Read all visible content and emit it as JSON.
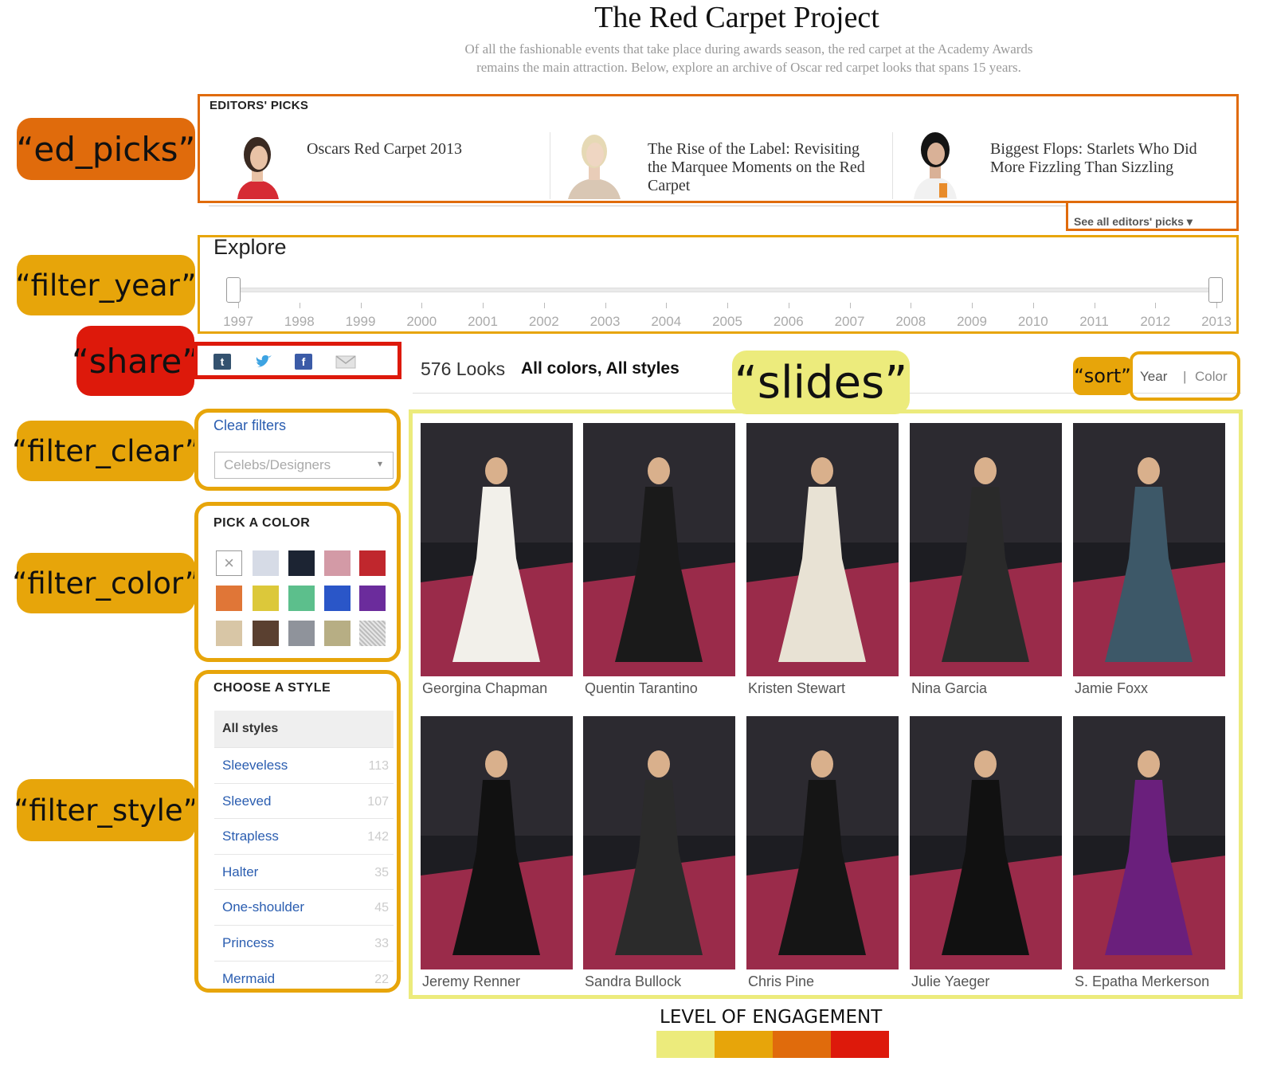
{
  "header": {
    "title": "The Red Carpet Project",
    "subtitle_line1": "Of all the fashionable events that take place during awards season, the red carpet at the Academy Awards",
    "subtitle_line2": "remains the main attraction. Below, explore an archive of Oscar red carpet looks that spans 15 years."
  },
  "annotations": {
    "ed_picks": "“ed_picks”",
    "filter_year": "“filter_year”",
    "share": "“share”",
    "filter_clear": "“filter_clear”",
    "filter_color": "“filter_color”",
    "filter_style": "“filter_style”",
    "slides": "“slides”",
    "sort": "“sort”"
  },
  "editors_picks": {
    "header": "EDITORS' PICKS",
    "items": [
      {
        "title": "Oscars Red Carpet 2013"
      },
      {
        "title": "The Rise of the Label: Revisiting the Marquee Moments on the Red Carpet"
      },
      {
        "title": "Biggest Flops: Starlets Who Did More Fizzling Than Sizzling"
      }
    ],
    "see_all": "See all editors' picks ▾"
  },
  "explore": {
    "label": "Explore",
    "years": [
      "1997",
      "1998",
      "1999",
      "2000",
      "2001",
      "2002",
      "2003",
      "2004",
      "2005",
      "2006",
      "2007",
      "2008",
      "2009",
      "2010",
      "2011",
      "2012",
      "2013"
    ],
    "selected_range": [
      "1997",
      "2013"
    ]
  },
  "share": {
    "icons": [
      "tumblr-icon",
      "twitter-icon",
      "facebook-icon",
      "email-icon"
    ],
    "tumblr_glyph": "t",
    "facebook_glyph": "f"
  },
  "looks": {
    "count": "576 Looks",
    "filters": "All colors, All styles"
  },
  "sort": {
    "year": "Year",
    "separator": "|",
    "color": "Color"
  },
  "filter_clear": {
    "link": "Clear filters",
    "select_value": "Celebs/Designers",
    "select_arrow": "▾"
  },
  "filter_color": {
    "title": "PICK A COLOR",
    "clear_glyph": "×",
    "swatches": [
      "#ffffff",
      "#d6dbe6",
      "#1c2433",
      "#d39aa6",
      "#c0272d",
      "#e07637",
      "#dcc83a",
      "#5cbf8c",
      "#2a56c8",
      "#6b2c9c",
      "#d8c6a6",
      "#5a4030",
      "#8f939b",
      "#b7ae84",
      "#d9d9d9"
    ]
  },
  "filter_style": {
    "title": "CHOOSE A STYLE",
    "all": "All styles",
    "items": [
      {
        "name": "Sleeveless",
        "count": "113"
      },
      {
        "name": "Sleeved",
        "count": "107"
      },
      {
        "name": "Strapless",
        "count": "142"
      },
      {
        "name": "Halter",
        "count": "35"
      },
      {
        "name": "One-shoulder",
        "count": "45"
      },
      {
        "name": "Princess",
        "count": "33"
      },
      {
        "name": "Mermaid",
        "count": "22"
      }
    ]
  },
  "slides": {
    "items": [
      {
        "name": "Georgina Chapman"
      },
      {
        "name": "Quentin Tarantino"
      },
      {
        "name": "Kristen Stewart"
      },
      {
        "name": "Nina Garcia"
      },
      {
        "name": "Jamie Foxx"
      },
      {
        "name": "Jeremy Renner"
      },
      {
        "name": "Sandra Bullock"
      },
      {
        "name": "Chris Pine"
      },
      {
        "name": "Julie Yaeger"
      },
      {
        "name": "S. Epatha Merkerson"
      }
    ]
  },
  "legend": {
    "label": "LEVEL OF ENGAGEMENT",
    "colors": [
      "#eceb7c",
      "#e7a50a",
      "#e06b0c",
      "#dd190b"
    ]
  }
}
